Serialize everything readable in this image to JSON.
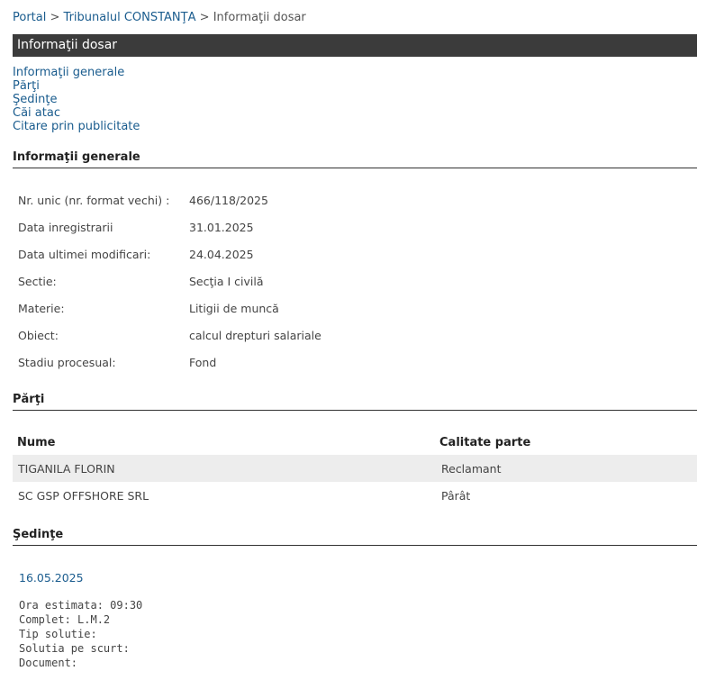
{
  "breadcrumb": {
    "portal": "Portal",
    "sep": ">",
    "court": "Tribunalul CONSTANŢA",
    "current": "Informaţii dosar"
  },
  "page_title": "Informaţii dosar",
  "nav": [
    "Informaţii generale",
    "Părţi",
    "Şedinţe",
    "Căi atac",
    "Citare prin publicitate"
  ],
  "sections": {
    "info": "Informaţii generale",
    "parti": "Părţi",
    "sedinte": "Şedinţe"
  },
  "info": [
    {
      "label": "Nr. unic (nr. format vechi) :",
      "value": "466/118/2025"
    },
    {
      "label": "Data inregistrarii",
      "value": "31.01.2025"
    },
    {
      "label": "Data ultimei modificari:",
      "value": "24.04.2025"
    },
    {
      "label": "Sectie:",
      "value": "Secţia I civilă"
    },
    {
      "label": "Materie:",
      "value": "Litigii de muncă"
    },
    {
      "label": "Obiect:",
      "value": "calcul drepturi salariale"
    },
    {
      "label": "Stadiu procesual:",
      "value": "Fond"
    }
  ],
  "parti": {
    "headers": [
      "Nume",
      "Calitate parte"
    ],
    "rows": [
      [
        "TIGANILA FLORIN",
        "Reclamant"
      ],
      [
        "SC GSP OFFSHORE SRL",
        "Pârât"
      ]
    ]
  },
  "sedinta": {
    "date": "16.05.2025",
    "details": [
      "Ora estimata: 09:30",
      "Complet: L.M.2",
      "Tip solutie:",
      "Solutia pe scurt:",
      "Document:"
    ]
  }
}
